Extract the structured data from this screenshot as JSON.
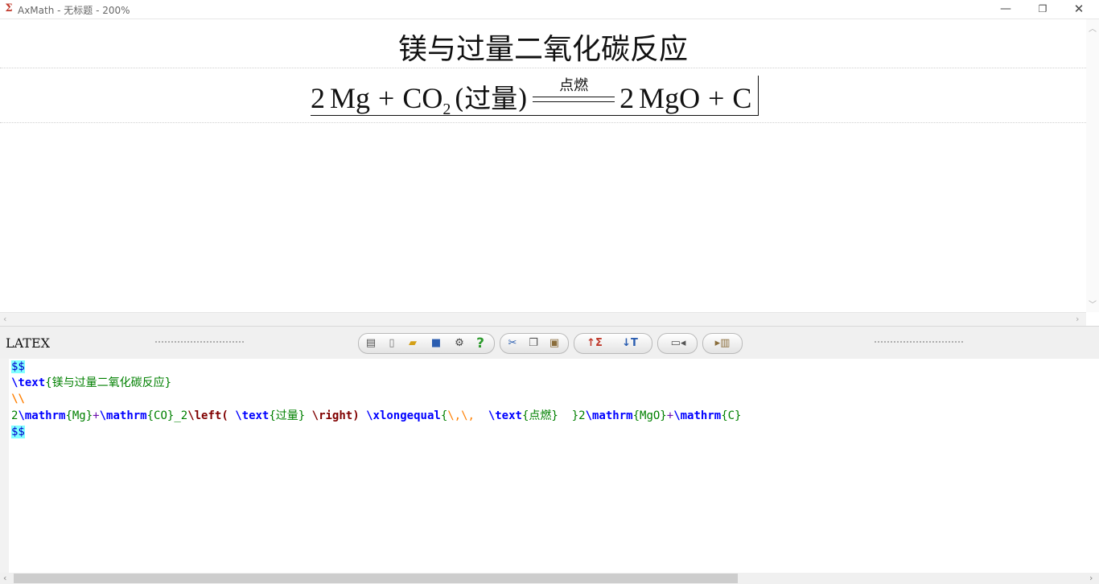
{
  "window": {
    "title": "AxMath - 无标题 - 200%",
    "app_icon": "Σ",
    "minimize": "—",
    "restore": "❐",
    "close": "✕"
  },
  "document": {
    "title": "镁与过量二氧化碳反应",
    "equation": {
      "lhs_coef": "2",
      "lhs_mg": "Mg",
      "plus1": "+",
      "co": "CO",
      "co_sub": "2",
      "paren_text": "(过量)",
      "condition": "点燃",
      "rhs_coef": "2",
      "rhs_mgo": "MgO",
      "plus2": "+",
      "c": "C"
    }
  },
  "toolbar": {
    "latex_label": "LATEX",
    "icons": [
      "menu-icon",
      "new-icon",
      "open-icon",
      "save-icon",
      "settings-icon",
      "help-icon",
      "cut-icon",
      "copy-icon",
      "paste-icon",
      "import-formula-icon",
      "export-text-icon",
      "folder-back-icon",
      "forward-book-icon"
    ]
  },
  "editor": {
    "line1": "$$",
    "line2_cmd": "\\text",
    "line2_arg": "{镁与过量二氧化碳反应}",
    "line3": "\\\\",
    "line4": {
      "a": "2",
      "b": "\\mathrm",
      "c": "{Mg}",
      "d": "+",
      "e": "\\mathrm",
      "f": "{CO}",
      "g": "_2",
      "h": "\\left(",
      "i": " \\text",
      "j": "{过量}",
      "k": " \\right)",
      "l": " \\xlongequal",
      "m": "{",
      "n": "\\,\\,",
      "o": "  \\text",
      "p": "{点燃}",
      "q": "  }",
      "r": "2",
      "s": "\\mathrm",
      "t": "{MgO}",
      "u": "+",
      "v": "\\mathrm",
      "w": "{C}"
    },
    "line5": "$$"
  }
}
